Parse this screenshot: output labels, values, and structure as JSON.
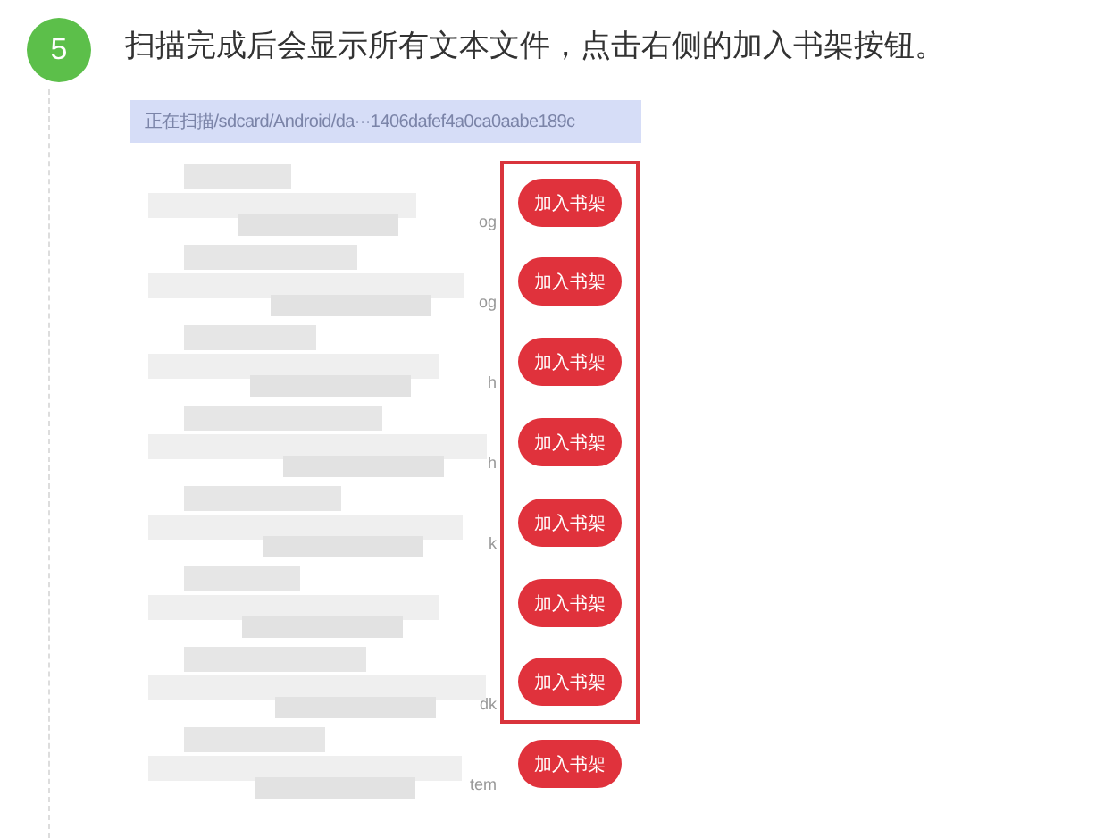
{
  "step": {
    "number": "5",
    "text": "扫描完成后会显示所有文本文件，点击右侧的加入书架按钮。"
  },
  "screenshot": {
    "scan_status": "正在扫描/sdcard/Android/da···1406dafef4a0ca0aabe189c",
    "rows": [
      {
        "suffix": "og",
        "button": "加入书架",
        "highlighted": true
      },
      {
        "suffix": "og",
        "button": "加入书架",
        "highlighted": true
      },
      {
        "suffix": "h",
        "button": "加入书架",
        "highlighted": true
      },
      {
        "suffix": "h",
        "button": "加入书架",
        "highlighted": true
      },
      {
        "suffix": "k",
        "button": "加入书架",
        "highlighted": true
      },
      {
        "suffix": "",
        "button": "加入书架",
        "highlighted": true
      },
      {
        "suffix": "dk",
        "button": "加入书架",
        "highlighted": true
      },
      {
        "suffix": "tem",
        "button": "加入书架",
        "highlighted": false
      }
    ]
  }
}
